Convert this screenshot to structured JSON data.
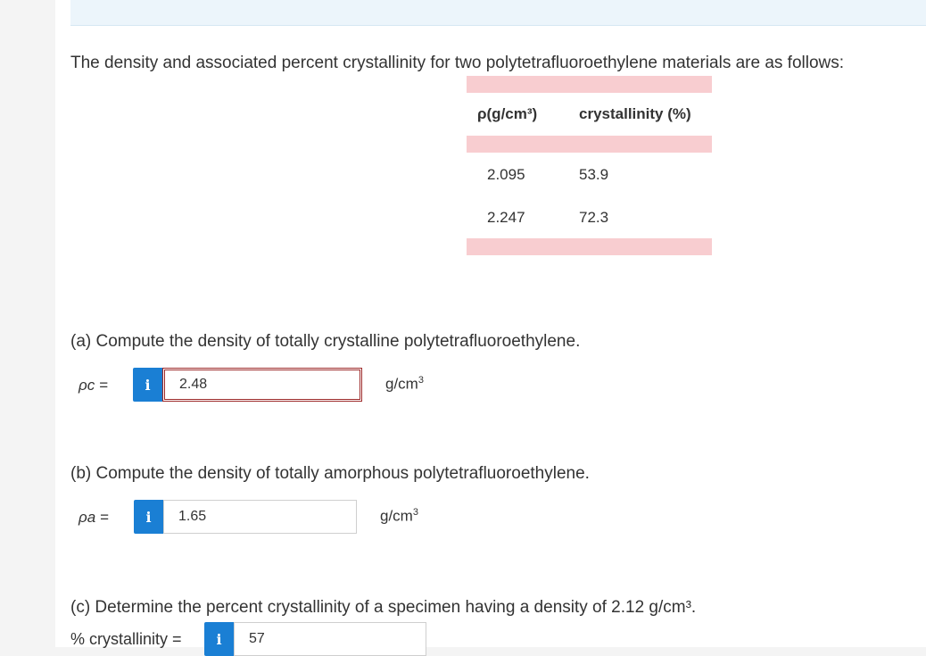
{
  "intro_text": "The density and associated percent crystallinity for two polytetrafluoroethylene materials are as follows:",
  "table": {
    "headers": [
      "ρ(g/cm³)",
      "crystallinity (%)"
    ],
    "rows": [
      [
        "2.095",
        "53.9"
      ],
      [
        "2.247",
        "72.3"
      ]
    ]
  },
  "part_a": {
    "question": "(a) Compute the density of totally crystalline polytetrafluoroethylene.",
    "label": "ρc =",
    "value": "2.48",
    "unit": "g/cm",
    "unit_exp": "3"
  },
  "part_b": {
    "question": "(b) Compute the density of totally amorphous polytetrafluoroethylene.",
    "label": "ρa =",
    "value": "1.65",
    "unit": "g/cm",
    "unit_exp": "3"
  },
  "part_c": {
    "question": "(c) Determine the percent crystallinity of a specimen having a density of 2.12 g/cm³.",
    "label": "% crystallinity =",
    "value": "57"
  },
  "info_glyph": "i",
  "colors": {
    "table_band": "#f8cdd0",
    "info_button": "#1a7fd4",
    "error_border": "#9d2a2a"
  }
}
